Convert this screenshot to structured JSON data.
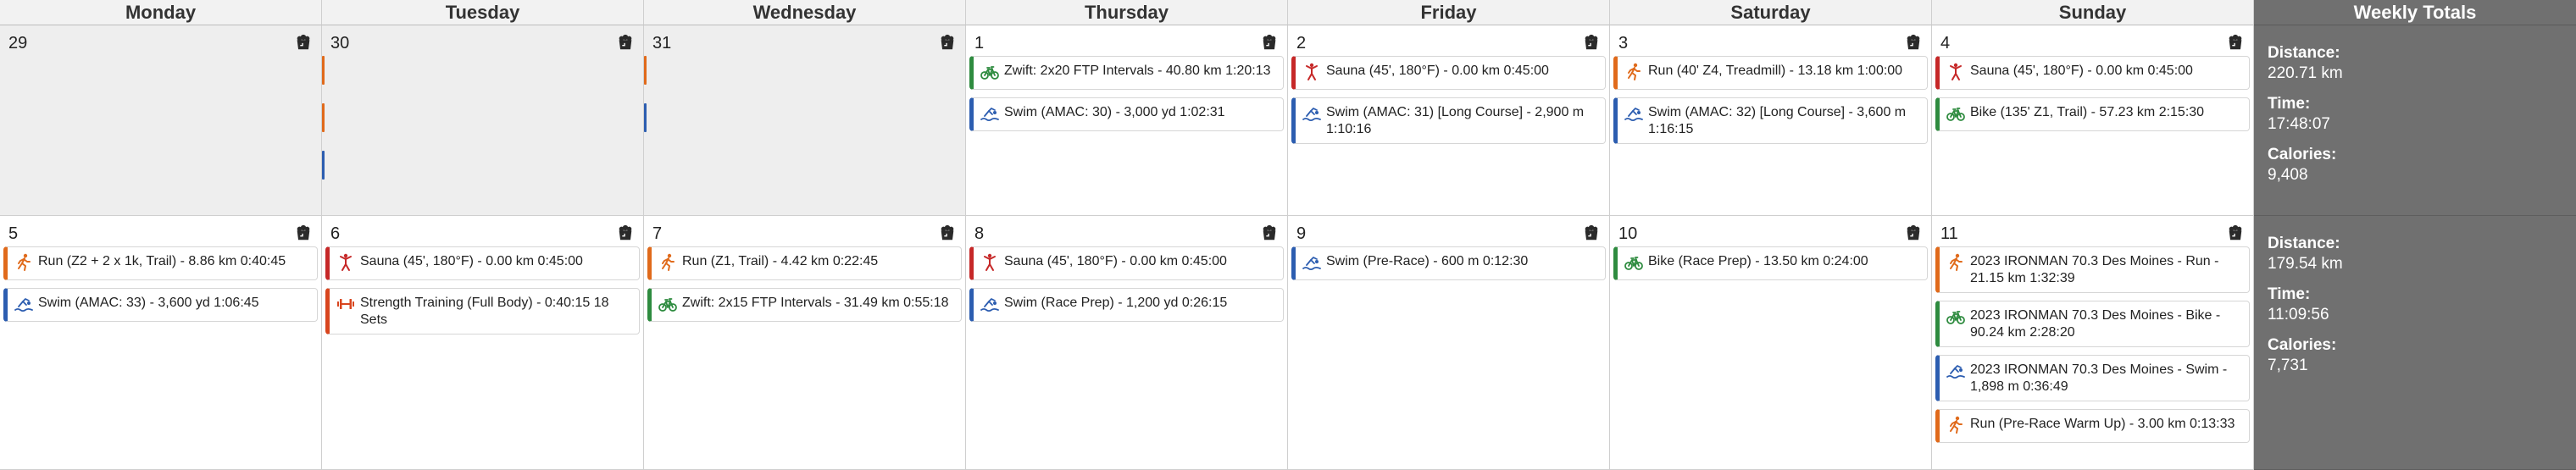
{
  "headers": [
    "Monday",
    "Tuesday",
    "Wednesday",
    "Thursday",
    "Friday",
    "Saturday",
    "Sunday"
  ],
  "totals_header": "Weekly Totals",
  "weeks": [
    {
      "days": [
        {
          "num": "29",
          "past": true,
          "activities": [],
          "stubs": []
        },
        {
          "num": "30",
          "past": true,
          "activities": [],
          "stubs": [
            "run",
            "run",
            "swim"
          ]
        },
        {
          "num": "31",
          "past": true,
          "activities": [],
          "stubs": [
            "run",
            "swim"
          ]
        },
        {
          "num": "1",
          "activities": [
            {
              "type": "bike",
              "icon": "bike-icon",
              "text": "Zwift: 2x20 FTP Intervals - 40.80 km 1:20:13"
            },
            {
              "type": "swim",
              "icon": "swim-icon",
              "text": "Swim (AMAC: 30) - 3,000 yd 1:02:31"
            }
          ]
        },
        {
          "num": "2",
          "activities": [
            {
              "type": "sauna",
              "icon": "sauna-icon",
              "text": "Sauna (45', 180°F) - 0.00 km 0:45:00"
            },
            {
              "type": "swim",
              "icon": "swim-icon",
              "text": "Swim (AMAC: 31) [Long Course] - 2,900 m 1:10:16"
            }
          ]
        },
        {
          "num": "3",
          "activities": [
            {
              "type": "run",
              "icon": "run-icon",
              "text": "Run (40' Z4, Treadmill) - 13.18 km 1:00:00"
            },
            {
              "type": "swim",
              "icon": "swim-icon",
              "text": "Swim (AMAC: 32) [Long Course] - 3,600 m 1:16:15"
            }
          ]
        },
        {
          "num": "4",
          "activities": [
            {
              "type": "sauna",
              "icon": "sauna-icon",
              "text": "Sauna (45', 180°F) - 0.00 km 0:45:00"
            },
            {
              "type": "bike",
              "icon": "bike-icon",
              "text": "Bike (135' Z1, Trail) - 57.23 km 2:15:30"
            }
          ]
        }
      ],
      "totals": {
        "distance_label": "Distance:",
        "distance": "220.71 km",
        "time_label": "Time:",
        "time": "17:48:07",
        "calories_label": "Calories:",
        "calories": "9,408"
      }
    },
    {
      "days": [
        {
          "num": "5",
          "activities": [
            {
              "type": "run",
              "icon": "run-icon",
              "text": "Run (Z2 + 2 x 1k, Trail) - 8.86 km 0:40:45"
            },
            {
              "type": "swim",
              "icon": "swim-icon",
              "text": "Swim (AMAC: 33) - 3,600 yd 1:06:45"
            }
          ]
        },
        {
          "num": "6",
          "activities": [
            {
              "type": "sauna",
              "icon": "sauna-icon",
              "text": "Sauna (45', 180°F) - 0.00 km 0:45:00"
            },
            {
              "type": "strength",
              "icon": "dumbbell-icon",
              "text": "Strength Training (Full Body) - 0:40:15 18 Sets"
            }
          ]
        },
        {
          "num": "7",
          "activities": [
            {
              "type": "run",
              "icon": "run-icon",
              "text": "Run (Z1, Trail) - 4.42 km 0:22:45"
            },
            {
              "type": "bike",
              "icon": "bike-icon",
              "text": "Zwift: 2x15 FTP Intervals - 31.49 km 0:55:18"
            }
          ]
        },
        {
          "num": "8",
          "activities": [
            {
              "type": "sauna",
              "icon": "sauna-icon",
              "text": "Sauna (45', 180°F) - 0.00 km 0:45:00"
            },
            {
              "type": "swim",
              "icon": "swim-icon",
              "text": "Swim (Race Prep) - 1,200 yd 0:26:15"
            }
          ]
        },
        {
          "num": "9",
          "activities": [
            {
              "type": "swim",
              "icon": "swim-icon",
              "text": "Swim (Pre-Race) - 600 m 0:12:30"
            }
          ]
        },
        {
          "num": "10",
          "activities": [
            {
              "type": "bike",
              "icon": "bike-icon",
              "text": "Bike (Race Prep) - 13.50 km 0:24:00"
            }
          ]
        },
        {
          "num": "11",
          "activities": [
            {
              "type": "run",
              "icon": "run-icon",
              "text": "2023 IRONMAN 70.3 Des Moines - Run - 21.15 km 1:32:39"
            },
            {
              "type": "bike",
              "icon": "bike-icon",
              "text": "2023 IRONMAN 70.3 Des Moines - Bike - 90.24 km 2:28:20"
            },
            {
              "type": "swim",
              "icon": "swim-icon",
              "text": "2023 IRONMAN 70.3 Des Moines - Swim - 1,898 m 0:36:49"
            },
            {
              "type": "run",
              "icon": "run-icon",
              "text": "Run (Pre-Race Warm Up) - 3.00 km 0:13:33"
            }
          ]
        }
      ],
      "totals": {
        "distance_label": "Distance:",
        "distance": "179.54 km",
        "time_label": "Time:",
        "time": "11:09:56",
        "calories_label": "Calories:",
        "calories": "7,731"
      }
    }
  ],
  "colors": {
    "bike": "#2e8b3f",
    "swim": "#2c5db0",
    "run": "#e06a1b",
    "sauna": "#c62828",
    "strength": "#d8451e",
    "day_icon": "#2a2a2a",
    "totals_bg": "#707070"
  }
}
